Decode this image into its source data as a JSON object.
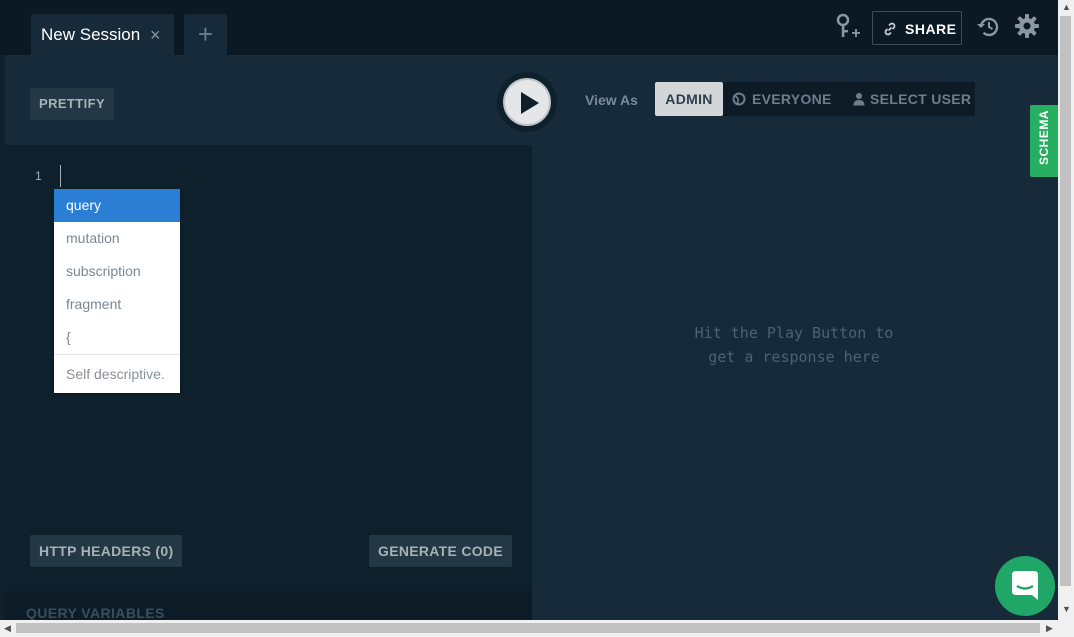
{
  "tabs": {
    "active": {
      "title": "New Session",
      "close": "×"
    },
    "add": "+"
  },
  "toolbar": {
    "share_label": "SHARE",
    "icons": [
      "key-add-icon",
      "link-icon",
      "history-icon",
      "gear-icon"
    ]
  },
  "editor": {
    "prettify_label": "PRETTIFY",
    "line_number": "1",
    "autocomplete": {
      "items": [
        "query",
        "mutation",
        "subscription",
        "fragment",
        "{"
      ],
      "selected_index": 0,
      "description": "Self descriptive."
    },
    "http_headers_label": "HTTP HEADERS (0)",
    "generate_code_label": "GENERATE CODE",
    "query_variables_label": "QUERY VARIABLES"
  },
  "result": {
    "view_as_label": "View As",
    "roles": [
      "ADMIN",
      "EVERYONE",
      "SELECT USER"
    ],
    "active_role": "ADMIN",
    "placeholder_line1": "Hit the Play Button to",
    "placeholder_line2": "get a response here"
  },
  "schema_label": "SCHEMA",
  "colors": {
    "accent_blue": "#2a7ed3",
    "schema_green": "#27ae60",
    "chat_green": "#20a666",
    "panel": "#172a3a",
    "background": "#0f202d"
  }
}
